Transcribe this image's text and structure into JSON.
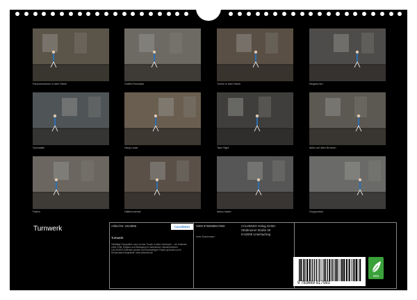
{
  "calendar": {
    "title": "Turnwerk",
    "thumbnails": [
      {
        "caption": "Pauschenturnen in alter Fabrik"
      },
      {
        "caption": "Graffiti-Feestücke"
      },
      {
        "caption": "Turnen in alter Fabrik"
      },
      {
        "caption": "Ringeturnen"
      },
      {
        "caption": "Gymnastik"
      },
      {
        "caption": "Hang Loose"
      },
      {
        "caption": "Take Flight"
      },
      {
        "caption": "Aktiro auf alten Brunnen"
      },
      {
        "caption": "Falken"
      },
      {
        "caption": "Halbtrennende"
      },
      {
        "caption": "Aktiro-Hallen"
      },
      {
        "caption": "Gruppenbild"
      }
    ]
  },
  "info": {
    "article": "Artikel-Nr: 2424856",
    "isbn": "ISBN 9783669817593",
    "publisher": [
      "CALVENDO Verlag GmbH",
      "Ottobrunner Straße 39",
      "D-82008 Unterhaching"
    ],
    "calendar_name": "Turnwerk",
    "author": "Irene Zimmermann",
    "logo_text": "CALVENDO",
    "barcode_number": "9 783669 817593",
    "description": "Vielfältige Fotografien rund um das Turnen in alten Gemäuern – ein Kalender voller Kraft, Eleganz und Bewegung in historischen Industrieräumen. CALVENDO Kalender werden auf hochwertigem Papier gedruckt und in Deutschland hergestellt. www.calvendo.de"
  },
  "colors": {
    "background": "#000000",
    "frame": "#ffffff",
    "accent": "#1a73c7",
    "eco": "#3aa13a"
  }
}
